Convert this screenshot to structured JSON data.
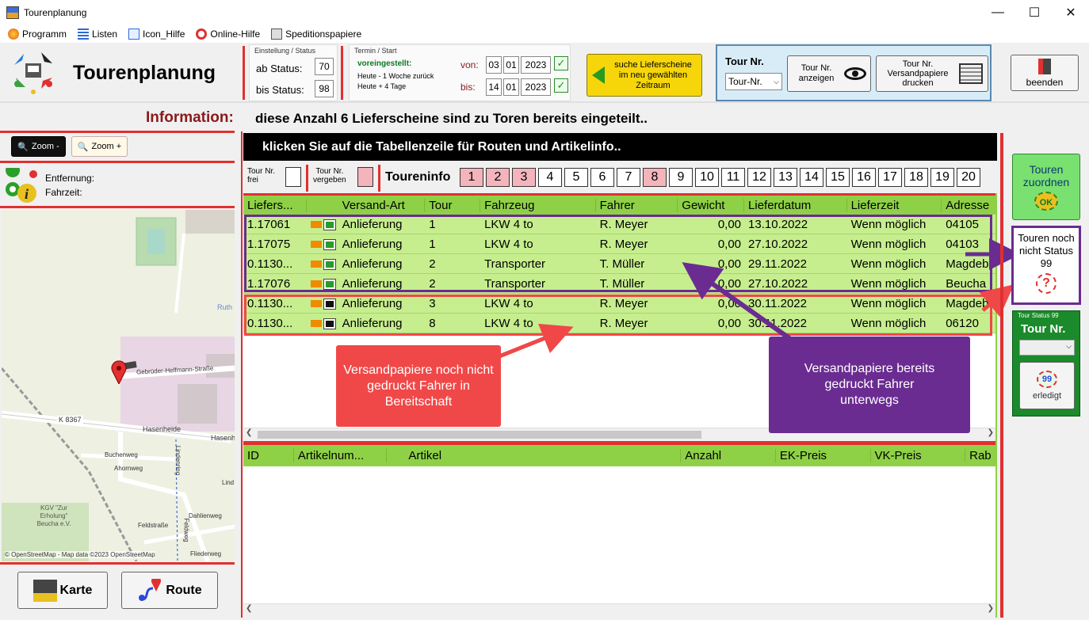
{
  "window": {
    "title": "Tourenplanung"
  },
  "menu": [
    {
      "label": "Programm",
      "icon": "firefox-icon"
    },
    {
      "label": "Listen",
      "icon": "list-icon"
    },
    {
      "label": "Icon_Hilfe",
      "icon": "edit-icon"
    },
    {
      "label": "Online-Hilfe",
      "icon": "lifebuoy-icon"
    },
    {
      "label": "Speditionspapiere",
      "icon": "document-icon"
    }
  ],
  "header": {
    "title": "Tourenplanung"
  },
  "status_panel": {
    "caption": "Einstellung / Status",
    "ab_label": "ab Status:",
    "ab_value": "70",
    "bis_label": "bis Status:",
    "bis_value": "98"
  },
  "termin_panel": {
    "caption": "Termin / Start",
    "preset_label": "voreingestellt:",
    "preset_line1": "Heute - 1 Woche zurück",
    "preset_line2": "Heute + 4 Tage",
    "von_label": "von:",
    "von_day": "03",
    "von_month": "01",
    "von_year": "2023",
    "bis_label": "bis:",
    "bis_day": "14",
    "bis_month": "01",
    "bis_year": "2023",
    "search_button": "suche Lieferscheine im neu gewählten Zeitraum"
  },
  "tour_panel": {
    "label": "Tour Nr.",
    "select_value": "Tour-Nr.",
    "show_button": "Tour Nr. anzeigen",
    "print_button": "Tour Nr. Versandpapiere drucken"
  },
  "exit_button": "beenden",
  "info": {
    "label": "Information:",
    "text": "diese Anzahl 6 Lieferscheine sind zu Toren bereits eingeteilt.."
  },
  "zoom": {
    "minus": "Zoom -",
    "plus": "Zoom +"
  },
  "distance": {
    "entfernung": "Entfernung:",
    "fahrzeit": "Fahrzeit:"
  },
  "map": {
    "labels": [
      "Gebrüder-Helfmann-Straße",
      "K 8367",
      "Hasenheide",
      "Hasenh",
      "Buchenweg",
      "Ahornweg",
      "Lindenring",
      "Dahlienweg",
      "Feldstraße",
      "Fliederweg",
      "Ruth",
      "Lind",
      "KGV \"Zur Erholung\" Beucha e.V.",
      "Feldweg"
    ],
    "attribution": "© OpenStreetMap - Map data ©2023 OpenStreetMap"
  },
  "bottom_buttons": {
    "karte": "Karte",
    "route": "Route"
  },
  "table_banner": "klicken Sie auf die Tabellenzeile für Routen und Artikelinfo..",
  "legend": {
    "frei_line1": "Tour Nr.",
    "frei_line2": "frei",
    "vergeben_line1": "Tour Nr.",
    "vergeben_line2": "vergeben",
    "toureninfo": "Toureninfo"
  },
  "tour_numbers": [
    {
      "n": "1",
      "assigned": true
    },
    {
      "n": "2",
      "assigned": true
    },
    {
      "n": "3",
      "assigned": true
    },
    {
      "n": "4",
      "assigned": false
    },
    {
      "n": "5",
      "assigned": false
    },
    {
      "n": "6",
      "assigned": false
    },
    {
      "n": "7",
      "assigned": false
    },
    {
      "n": "8",
      "assigned": true
    },
    {
      "n": "9",
      "assigned": false
    },
    {
      "n": "10",
      "assigned": false
    },
    {
      "n": "11",
      "assigned": false
    },
    {
      "n": "12",
      "assigned": false
    },
    {
      "n": "13",
      "assigned": false
    },
    {
      "n": "14",
      "assigned": false
    },
    {
      "n": "15",
      "assigned": false
    },
    {
      "n": "16",
      "assigned": false
    },
    {
      "n": "17",
      "assigned": false
    },
    {
      "n": "18",
      "assigned": false
    },
    {
      "n": "19",
      "assigned": false
    },
    {
      "n": "20",
      "assigned": false
    }
  ],
  "main_table": {
    "columns": [
      "Liefers...",
      "",
      "Versand-Art",
      "Tour",
      "Fahrzeug",
      "Fahrer",
      "Gewicht",
      "Lieferdatum",
      "Lieferzeit",
      "Adresse"
    ],
    "rows": [
      [
        "1.17061",
        "printed",
        "Anlieferung",
        "1",
        "LKW 4 to",
        "R. Meyer",
        "0,00",
        "13.10.2022",
        "Wenn möglich",
        "04105"
      ],
      [
        "1.17075",
        "printed",
        "Anlieferung",
        "1",
        "LKW 4 to",
        "R. Meyer",
        "0,00",
        "27.10.2022",
        "Wenn möglich",
        "04103"
      ],
      [
        "0.1130...",
        "printed",
        "Anlieferung",
        "2",
        "Transporter",
        "T. Müller",
        "0,00",
        "29.11.2022",
        "Wenn möglich",
        "Magdeb"
      ],
      [
        "1.17076",
        "printed",
        "Anlieferung",
        "2",
        "Transporter",
        "T. Müller",
        "0,00",
        "27.10.2022",
        "Wenn möglich",
        " Beucha"
      ],
      [
        "0.1130...",
        "not-printed",
        "Anlieferung",
        "3",
        "LKW 4 to",
        "R. Meyer",
        "0,00",
        "30.11.2022",
        "Wenn möglich",
        "Magdeb"
      ],
      [
        "0.1130...",
        "not-printed",
        "Anlieferung",
        "8",
        "LKW 4 to",
        "R. Meyer",
        "0,00",
        "30.11.2022",
        "Wenn möglich",
        "06120"
      ]
    ]
  },
  "article_table": {
    "columns": [
      "ID",
      "Artikelnum...",
      "",
      "Artikel",
      "Anzahl",
      "EK-Preis",
      "VK-Preis",
      "Rab"
    ]
  },
  "callouts": {
    "red": "Versandpapiere noch nicht gedruckt Fahrer in Bereitschaft",
    "purple": "Versandpapiere bereits gedruckt Fahrer unterwegs"
  },
  "right_panel": {
    "assign_button": "Touren zuordnen",
    "assign_badge": "OK",
    "not_status": "Touren noch nicht Status 99",
    "status_caption": "Tour Status 99",
    "status_label": "Tour Nr.",
    "done_button": "erledigt",
    "done_badge": "99"
  },
  "colors": {
    "row_green": "#c6ee8e",
    "header_green": "#8fd146",
    "accent_red": "#e03030",
    "callout_red": "#f04848",
    "callout_purple": "#6a2c91",
    "pink": "#f4b4bc"
  }
}
